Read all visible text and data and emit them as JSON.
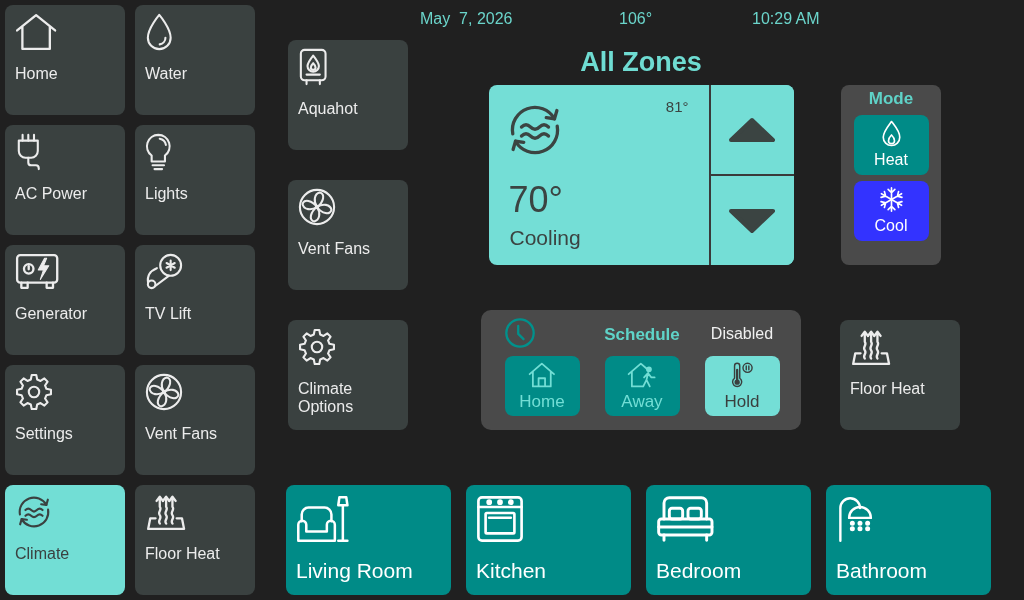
{
  "header": {
    "date": "May  7, 2026",
    "temperature": "106°",
    "time": "10:29 AM"
  },
  "sidebar": {
    "items": [
      {
        "label": "Home",
        "kind": "home",
        "selected": false
      },
      {
        "label": "Water",
        "kind": "water",
        "selected": false
      },
      {
        "label": "AC Power",
        "kind": "power",
        "selected": false
      },
      {
        "label": "Lights",
        "kind": "lights",
        "selected": false
      },
      {
        "label": "Generator",
        "kind": "generator",
        "selected": false
      },
      {
        "label": "TV Lift",
        "kind": "lift",
        "selected": false
      },
      {
        "label": "Settings",
        "kind": "settings",
        "selected": false
      },
      {
        "label": "Vent Fans",
        "kind": "fan",
        "selected": false
      },
      {
        "label": "Climate",
        "kind": "climate",
        "selected": true
      },
      {
        "label": "Floor Heat",
        "kind": "heating",
        "selected": false
      }
    ]
  },
  "shortcuts": [
    {
      "label": "Aquahot",
      "kind": "boiler"
    },
    {
      "label": "Vent Fans",
      "kind": "fan"
    },
    {
      "label": "Climate Options",
      "kind": "settings"
    }
  ],
  "zone": {
    "title": "All Zones",
    "reading": "81°",
    "setpoint": "70°",
    "status": "Cooling"
  },
  "mode": {
    "title": "Mode",
    "options": [
      {
        "label": "Heat",
        "kind": "heat",
        "selected": false
      },
      {
        "label": "Cool",
        "kind": "cool",
        "selected": true
      }
    ]
  },
  "schedule": {
    "title": "Schedule",
    "status": "Disabled",
    "options": [
      {
        "label": "Home",
        "kind": "home",
        "selected": false
      },
      {
        "label": "Away",
        "kind": "away",
        "selected": false
      },
      {
        "label": "Hold",
        "kind": "hold",
        "selected": true
      }
    ]
  },
  "floor_heat": {
    "label": "Floor Heat"
  },
  "rooms": [
    {
      "label": "Living Room",
      "kind": "living"
    },
    {
      "label": "Kitchen",
      "kind": "kitchen"
    },
    {
      "label": "Bedroom",
      "kind": "bed"
    },
    {
      "label": "Bathroom",
      "kind": "bath"
    }
  ]
}
